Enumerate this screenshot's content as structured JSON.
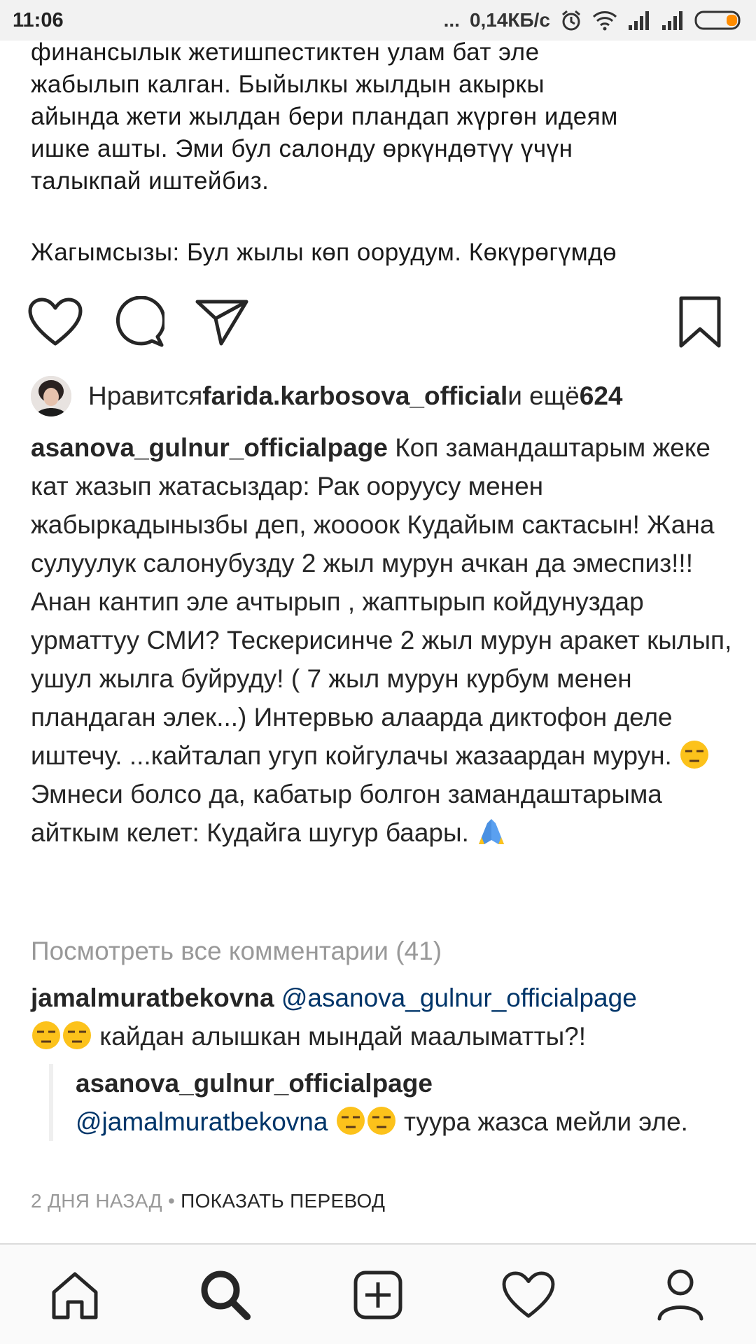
{
  "status_bar": {
    "time": "11:06",
    "dots": "...",
    "net_speed": "0,14КБ/с",
    "icons": [
      "alarm-icon",
      "wifi-icon",
      "signal-icon",
      "signal-icon",
      "battery-icon"
    ]
  },
  "post_image_text": {
    "paragraph1": [
      "финансылык жетишпестиктен улам бат эле",
      "жабылып калган. Быйылкы жылдын акыркы",
      "айында жети жылдан бери пландап жүргөн идеям",
      "ишке ашты. Эми бул салонду өркүндөтүү  үчүн",
      "талыкпай иштейбиз."
    ],
    "paragraph2": "Жагымсызы: Бул жылы көп оорудум. Көкүрөгүмдө"
  },
  "actions": {
    "like_icon": "heart-icon",
    "comment_icon": "comment-icon",
    "share_icon": "paper-plane-icon",
    "save_icon": "bookmark-icon"
  },
  "likes": {
    "prefix": "Нравится ",
    "user": "farida.karbosova_official",
    "middle": " и ещё ",
    "count": "624"
  },
  "caption": {
    "author": "asanova_gulnur_officialpage",
    "text1": " Коп замандаштарым жеке кат жазып жатасыздар: Рак ооруусу менен жабыркадынызбы деп, жоооок Кудайым сактасын! Жана сулуулук салонубузду 2 жыл мурун ачкан да эмеспиз!!! Анан кантип эле ачтырып , жаптырып койдунуздар урматтуу СМИ? Тескерисинче 2 жыл мурун аракет кылып, ушул жылга буйруду! ( 7 жыл мурун курбум менен пландаган элек...) Интервью  алаарда диктофон деле иштечу. ...кайталап угуп койгулачы жазаардан мурун. ",
    "text2": " Эмнеси болсо да, кабатыр болгон замандаштарыма айткым келет: Кудайга шугур баары. "
  },
  "view_all_comments": "Посмотреть все комментарии (41)",
  "comment": {
    "author": "jamalmuratbekovna",
    "mention": "@asanova_gulnur_officialpage",
    "text": " кайдан алышкан мындай маалыматты?!"
  },
  "reply": {
    "author": "asanova_gulnur_officialpage",
    "mention": "@jamalmuratbekovna",
    "text": " туура жазса мейли эле."
  },
  "meta": {
    "time_ago": "2 ДНЯ НАЗАД",
    "separator": " • ",
    "translate": "ПОКАЗАТЬ ПЕРЕВОД"
  },
  "bottom_nav": {
    "items": [
      "home-icon",
      "search-icon",
      "add-post-icon",
      "activity-heart-icon",
      "profile-icon"
    ]
  },
  "colors": {
    "text": "#262626",
    "muted": "#999999",
    "mention": "#003569",
    "battery_fill": "#ff8c00"
  }
}
